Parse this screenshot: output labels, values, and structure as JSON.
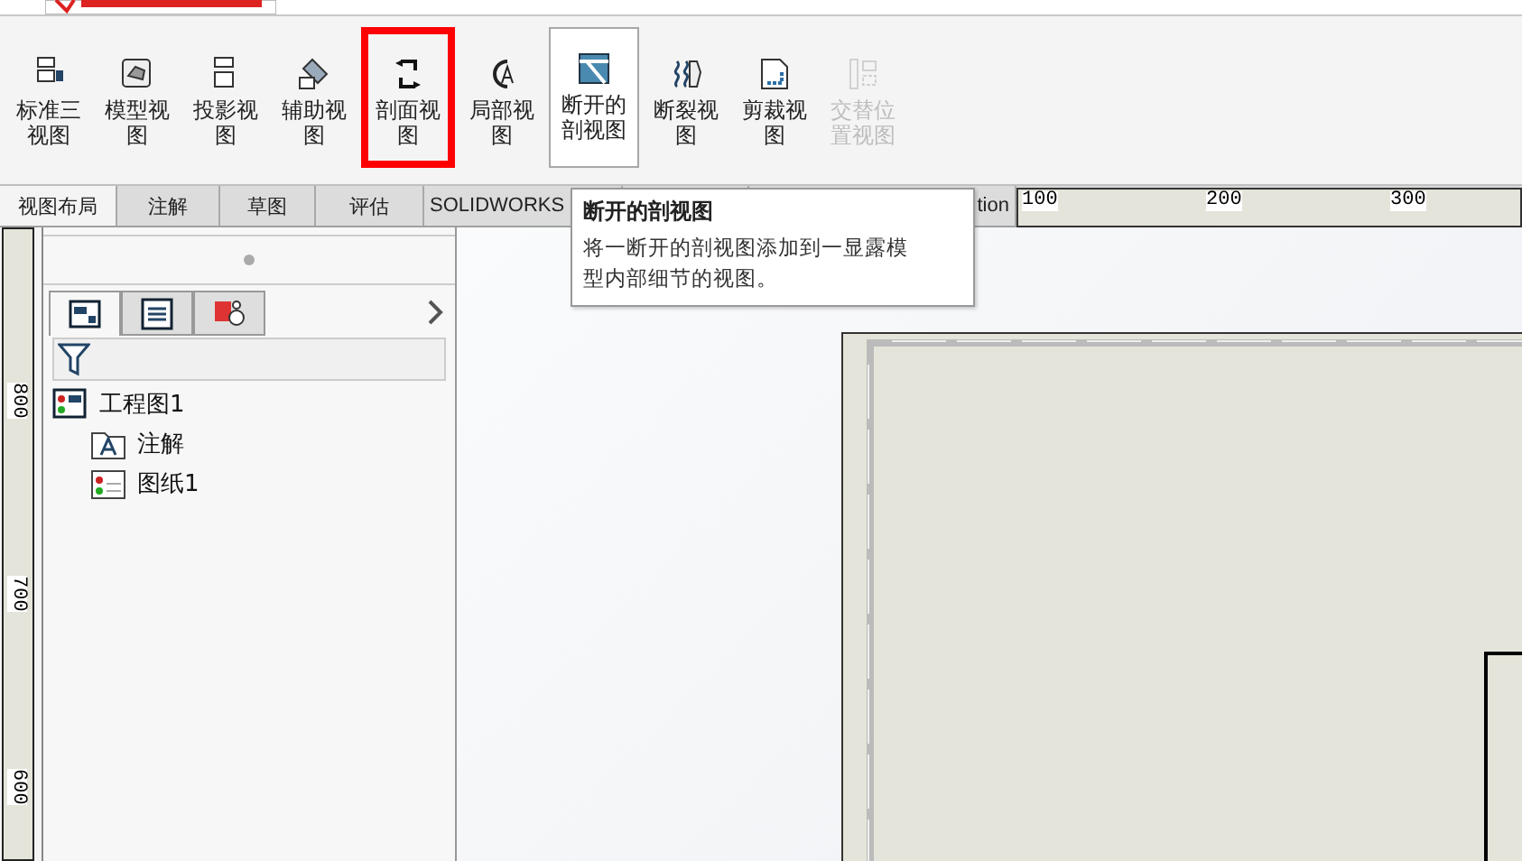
{
  "toolbar": {
    "buttons": [
      {
        "label": "标准三视图",
        "selected": false,
        "highlighted": false,
        "disabled": false
      },
      {
        "label": "模型视图",
        "selected": false,
        "highlighted": false,
        "disabled": false
      },
      {
        "label": "投影视图",
        "selected": false,
        "highlighted": false,
        "disabled": false
      },
      {
        "label": "辅助视图",
        "selected": false,
        "highlighted": false,
        "disabled": false
      },
      {
        "label": "剖面视图",
        "selected": false,
        "highlighted": true,
        "disabled": false
      },
      {
        "label": "局部视图",
        "selected": false,
        "highlighted": false,
        "disabled": false
      },
      {
        "label": "断开的剖视图",
        "selected": true,
        "highlighted": false,
        "disabled": false
      },
      {
        "label": "断裂视图",
        "selected": false,
        "highlighted": false,
        "disabled": false
      },
      {
        "label": "剪裁视图",
        "selected": false,
        "highlighted": false,
        "disabled": false
      },
      {
        "label": "交替位置视图",
        "selected": false,
        "highlighted": false,
        "disabled": true
      }
    ]
  },
  "tabs": [
    {
      "label": "视图布局",
      "selected": true
    },
    {
      "label": "注解",
      "selected": false
    },
    {
      "label": "草图",
      "selected": false
    },
    {
      "label": "评估",
      "selected": false
    },
    {
      "label": "SOLIDWORKS",
      "selected": false
    },
    {
      "selected": false
    },
    {
      "label": "tion",
      "selected": false
    }
  ],
  "tooltip": {
    "title": "断开的剖视图",
    "body": "将一断开的剖视图添加到一显露模型内部细节的视图。"
  },
  "top_ruler": {
    "labels": [
      "100",
      "200",
      "300"
    ]
  },
  "left_ruler": {
    "labels": [
      "800",
      "700",
      "600"
    ]
  },
  "panel": {
    "tabs": [
      {
        "selected": true
      },
      {
        "selected": false
      },
      {
        "selected": false
      }
    ],
    "tree": [
      {
        "label": "工程图1",
        "children": [
          {
            "label": "注解"
          },
          {
            "label": "图纸1"
          }
        ]
      }
    ]
  }
}
